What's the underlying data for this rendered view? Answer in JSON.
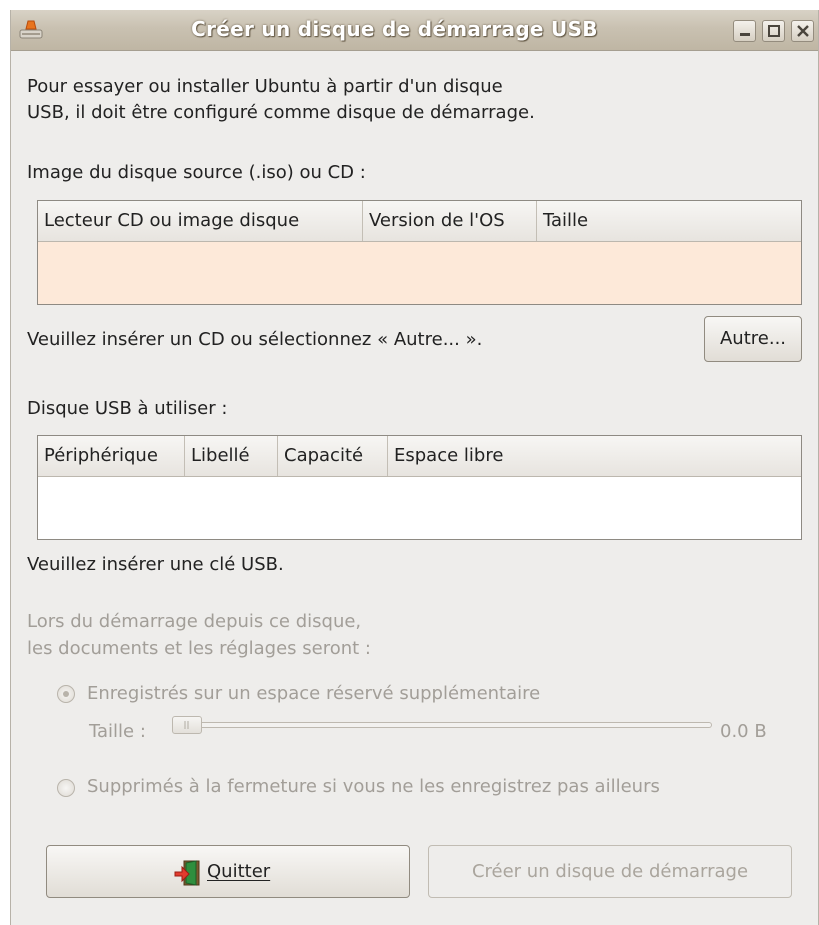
{
  "window": {
    "title": "Créer un disque de démarrage USB",
    "app_icon": "usb-creator-icon",
    "controls": [
      "minimize-icon",
      "maximize-icon",
      "close-icon"
    ]
  },
  "intro": {
    "line1": "Pour essayer ou installer Ubuntu à partir d'un disque",
    "line2": "USB, il doit être configuré comme disque de démarrage."
  },
  "source": {
    "label": "Image du disque source (.iso) ou CD :",
    "columns": [
      "Lecteur CD ou image disque",
      "Version de l'OS",
      "Taille"
    ],
    "rows": [],
    "status": "Veuillez insérer un CD ou sélectionnez « Autre... ».",
    "other_button": "Autre..."
  },
  "usb": {
    "label": "Disque USB à utiliser :",
    "columns": [
      "Périphérique",
      "Libellé",
      "Capacité",
      "Espace libre"
    ],
    "rows": [],
    "status": "Veuillez insérer une clé USB."
  },
  "persistence": {
    "line1": "Lors du démarrage depuis ce disque,",
    "line2": "les documents et les réglages seront :",
    "option_store": "Enregistrés sur un espace réservé supplémentaire",
    "size_label": "Taille :",
    "size_value": "0.0 B",
    "size_fraction": 0,
    "option_discard": "Supprimés à la fermeture si vous ne les enregistrez pas ailleurs",
    "selected": "store",
    "enabled": false
  },
  "buttons": {
    "quit": "Quitter",
    "quit_icon": "exit-icon",
    "create": "Créer un disque de démarrage"
  },
  "colors": {
    "source_list_bg": "#fde9d9",
    "usb_list_bg": "#ffffff",
    "window_bg": "#eeedeb",
    "disabled_text": "#a29e98"
  }
}
